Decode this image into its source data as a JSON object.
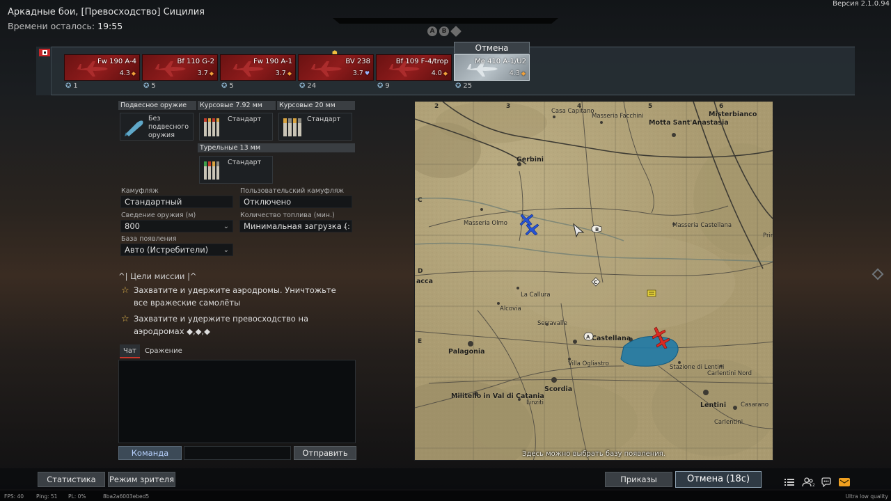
{
  "header": {
    "title": "Аркадные бои, [Превосходство] Сицилия",
    "timer_label": "Времени осталось:",
    "timer_value": "19:55",
    "version": "Версия 2.1.0.94"
  },
  "nav_dots": [
    "A",
    "B",
    "◆"
  ],
  "vehicles": [
    {
      "name": "Fw 190 A-4",
      "br": "4.3",
      "spawn": "1",
      "selected": false
    },
    {
      "name": "Bf 110 G-2",
      "br": "3.7",
      "spawn": "5",
      "selected": false
    },
    {
      "name": "Fw 190 A-1",
      "br": "3.7",
      "spawn": "5",
      "selected": false
    },
    {
      "name": "BV 238",
      "br": "3.7",
      "spawn": "24",
      "selected": false
    },
    {
      "name": "Bf 109 F-4/trop",
      "br": "4.0",
      "spawn": "9",
      "selected": false
    },
    {
      "name": "Me 410 A-1/U2",
      "br": "4.3",
      "spawn": "25",
      "selected": true
    }
  ],
  "selected_tab_label": "Отмена",
  "loadout": {
    "suspended_head": "Подвесное оружие",
    "suspended_value": "Без подвесного оружия",
    "gun1_head": "Курсовые 7.92 мм",
    "gun1_value": "Стандарт",
    "gun2_head": "Курсовые 20 мм",
    "gun2_value": "Стандарт",
    "turret_head": "Турельные 13 мм",
    "turret_value": "Стандарт"
  },
  "settings": {
    "camo_label": "Камуфляж",
    "camo_value": "Стандартный",
    "custom_camo_label": "Пользовательский камуфляж",
    "custom_camo_value": "Отключено",
    "convergence_label": "Сведение оружия (м)",
    "convergence_value": "800",
    "fuel_label": "Количество топлива (мин.)",
    "fuel_value": "Минимальная загрузка (:",
    "spawn_base_label": "База появления",
    "spawn_base_value": "Авто (Истребители)"
  },
  "missions": {
    "head": "Цели миссии",
    "items": [
      "Захватите и удержите аэродромы. Уничтожьте все вражеские самолёты",
      "Захватите и удержите превосходство на аэродромах ◆,◆,◆"
    ]
  },
  "chat": {
    "tab_chat": "Чат",
    "tab_battle": "Сражение",
    "team_button": "Команда",
    "send_button": "Отправить"
  },
  "map": {
    "caption": "Здесь можно выбрать базу появления.",
    "columns": [
      "2",
      "3",
      "4",
      "5",
      "6"
    ],
    "rows": [
      "C",
      "D",
      "E"
    ],
    "places": [
      {
        "id": "casa",
        "text": "Casa Capitano"
      },
      {
        "id": "facchini",
        "text": "Masseria Facchini"
      },
      {
        "id": "motta",
        "text": "Motta Sant'Anastasia"
      },
      {
        "id": "misterbianco",
        "text": "Misterbianco"
      },
      {
        "id": "gerbini",
        "text": "Gerbini"
      },
      {
        "id": "olmo",
        "text": "Masseria Olmo"
      },
      {
        "id": "castellana",
        "text": "Masseria Castellana"
      },
      {
        "id": "primo",
        "text": "Prim Be"
      },
      {
        "id": "acca",
        "text": "acca"
      },
      {
        "id": "callura",
        "text": "La Callura"
      },
      {
        "id": "alcovia",
        "text": "Alcovia"
      },
      {
        "id": "serravalle",
        "text": "Serravalle"
      },
      {
        "id": "cartellana",
        "text": "Castellana"
      },
      {
        "id": "palagonia",
        "text": "Palagonia"
      },
      {
        "id": "villa",
        "text": "Villa Ogliastro"
      },
      {
        "id": "scordia",
        "text": "Scordia"
      },
      {
        "id": "stazione",
        "text": "Stazione di Lentini"
      },
      {
        "id": "carlentini_nord",
        "text": "Carlentini Nord"
      },
      {
        "id": "militello",
        "text": "Militello in Val di Catania"
      },
      {
        "id": "linziti",
        "text": "Linziti"
      },
      {
        "id": "lentini",
        "text": "Lentini"
      },
      {
        "id": "casarano",
        "text": "Casarano"
      },
      {
        "id": "carlentini",
        "text": "Carlentini"
      }
    ],
    "airfields": [
      "A",
      "B",
      "C"
    ]
  },
  "bottom": {
    "stats_button": "Статистика",
    "spectator_button": "Режим зрителя",
    "orders_button": "Приказы",
    "cancel_button": "Отмена (18с)"
  },
  "status": {
    "fps": "FPS: 40",
    "ping": "Ping: 51",
    "pl": "PL: 0%",
    "session": "8ba2a6003ebed5",
    "quality": "Ultra low quality"
  },
  "colors": {
    "team_blue": "#2553d6",
    "enemy_red": "#d92a22",
    "accent_orange": "#f2a23a",
    "objective_gold": "#e2b64e"
  }
}
